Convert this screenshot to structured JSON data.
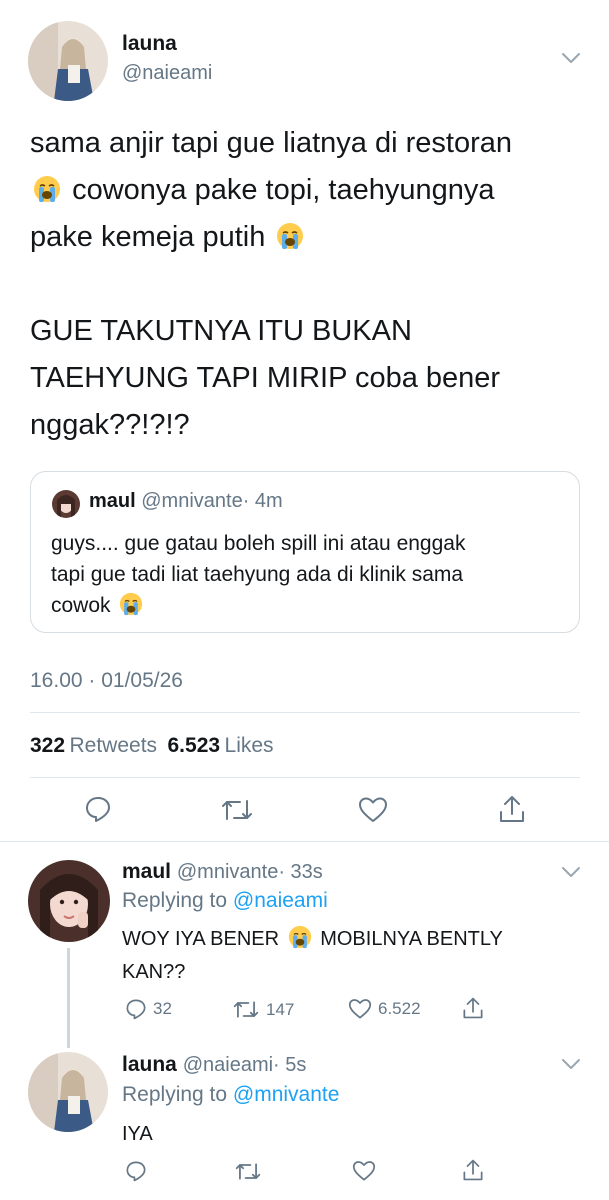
{
  "main_tweet": {
    "author_name": "launa",
    "author_handle": "@naieami",
    "text_line1": "sama anjir tapi gue liatnya di restoran",
    "text_line2": "cowonya pake topi, taehyungnya",
    "text_line3": "pake kemeja putih",
    "text_line4": "GUE TAKUTNYA ITU BUKAN",
    "text_line5": "TAEHYUNG TAPI MIRIP coba bener",
    "text_line6": "nggak??!?!?",
    "emoji_name": "loudly-crying-face-emoji",
    "quoted": {
      "author_name": "maul",
      "author_handle": "@mnivante",
      "time": "· 4m",
      "line1": "guys.... gue gatau boleh spill ini atau enggak",
      "line2": "tapi gue tadi liat taehyung ada di klinik sama",
      "line3": "cowok"
    },
    "timestamp": "16.00 · 01/05/26",
    "retweets_count": "322",
    "retweets_label": "Retweets",
    "likes_count": "6.523",
    "likes_label": "Likes"
  },
  "replies": [
    {
      "author_name": "maul",
      "author_handle": "@mnivante",
      "time": "· 33s",
      "replying_label": "Replying to",
      "replying_to": "@naieami",
      "text_a": "WOY IYA BENER",
      "text_b": "MOBILNYA BENTLY",
      "text_c": "KAN??",
      "reply_count": "32",
      "retweet_count": "147",
      "like_count": "6.522"
    },
    {
      "author_name": "launa",
      "author_handle": "@naieami",
      "time": "· 5s",
      "replying_label": "Replying to",
      "replying_to": "@mnivante",
      "text": "IYA"
    }
  ],
  "icons": [
    "reply-icon",
    "retweet-icon",
    "like-icon",
    "share-icon",
    "chevron-down-icon"
  ],
  "colors": {
    "link": "#1da1f2",
    "muted": "#657786",
    "text": "#14171a",
    "divider": "#e1e8ed"
  }
}
